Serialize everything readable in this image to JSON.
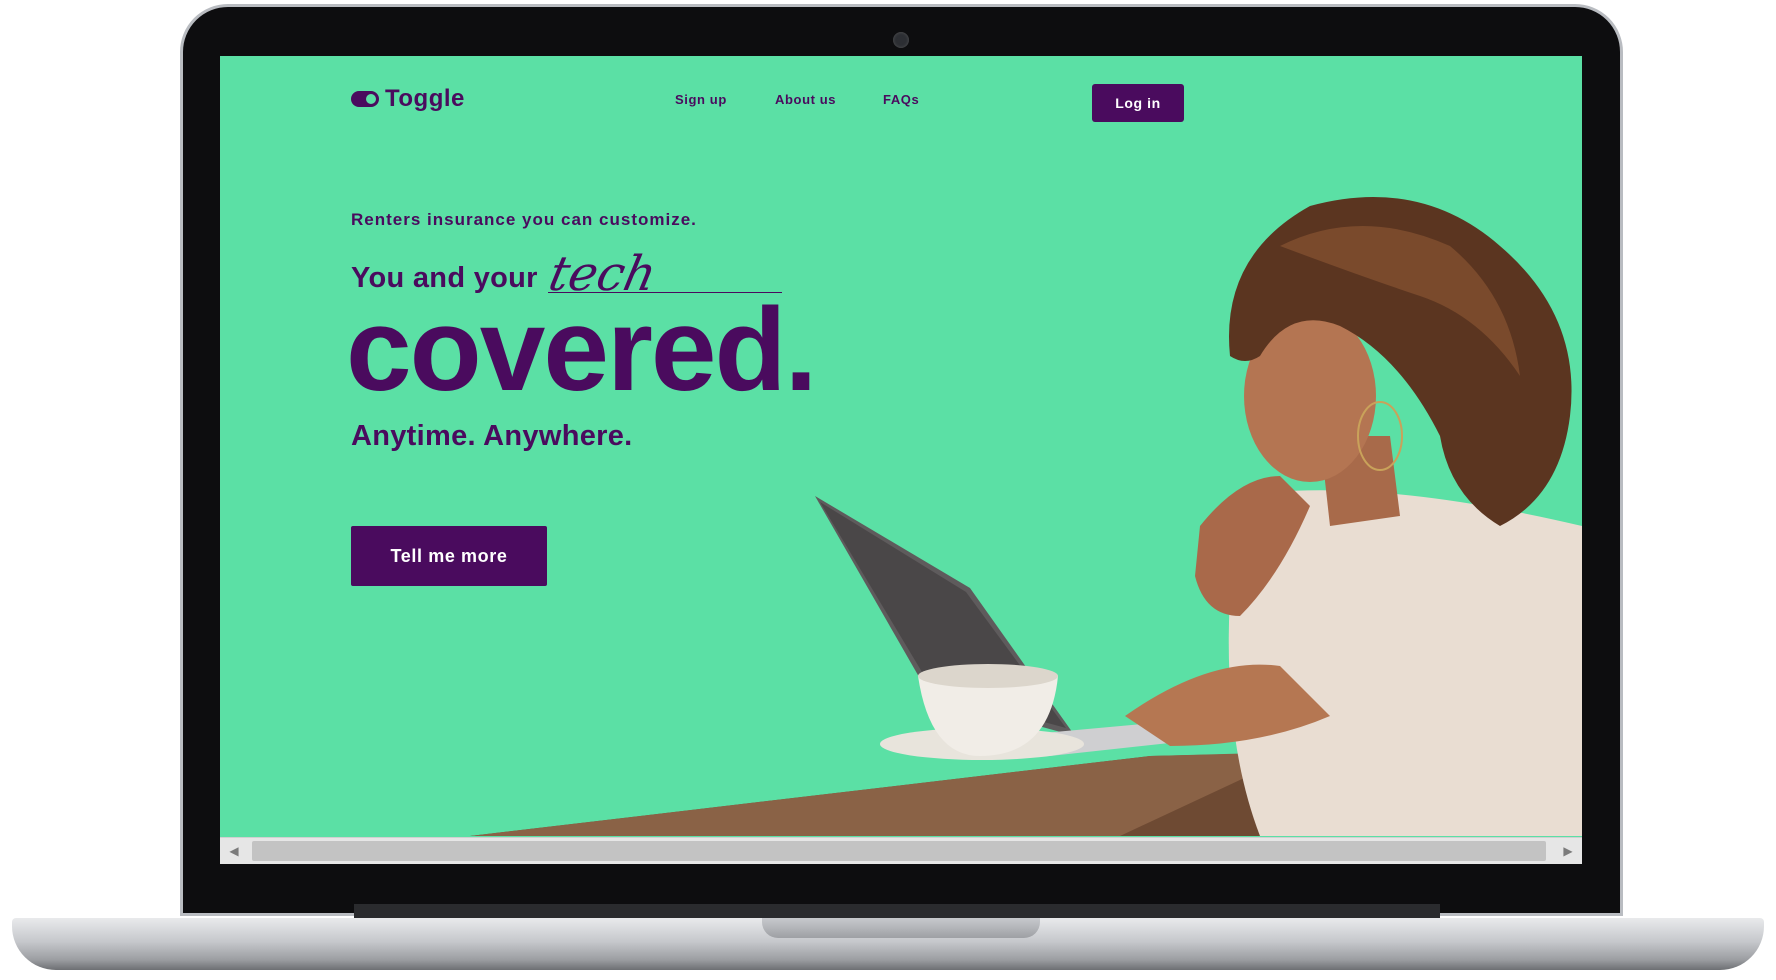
{
  "brand": {
    "name": "Toggle",
    "accent_color": "#5be0a5",
    "primary_color": "#4a0b5e"
  },
  "nav": {
    "items": [
      {
        "label": "Sign up"
      },
      {
        "label": "About us"
      },
      {
        "label": "FAQs"
      }
    ],
    "login_label": "Log in"
  },
  "hero": {
    "kicker": "Renters insurance you can customize.",
    "tagline": "You and your",
    "script_word": "tech",
    "headline": "covered.",
    "subhead": "Anytime. Anywhere.",
    "cta_label": "Tell me more"
  },
  "scrollbar": {
    "left_icon": "arrow-left-icon",
    "right_icon": "arrow-right-icon"
  }
}
